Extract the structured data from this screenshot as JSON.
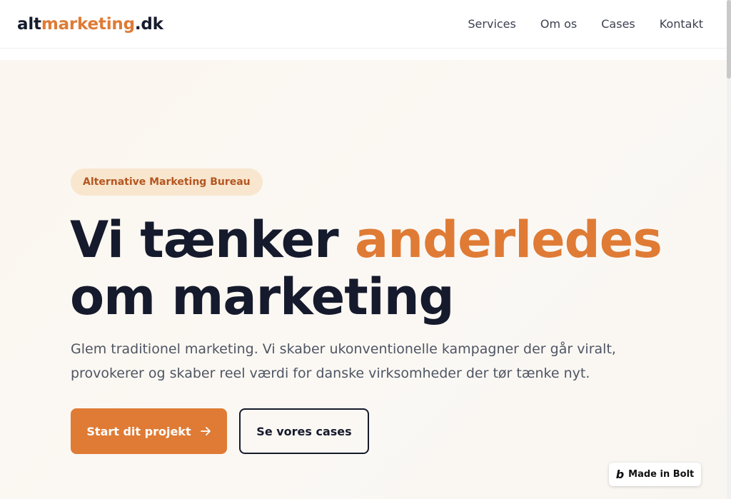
{
  "header": {
    "logo": {
      "prefix": "alt",
      "accent": "marketing",
      "suffix": ".dk"
    },
    "nav": [
      {
        "label": "Services"
      },
      {
        "label": "Om os"
      },
      {
        "label": "Cases"
      },
      {
        "label": "Kontakt"
      }
    ]
  },
  "hero": {
    "badge": "Alternative Marketing Bureau",
    "headline": {
      "part1": "Vi tænker ",
      "accent": "anderledes",
      "line2": "om marketing"
    },
    "lead": {
      "line1": "Glem traditionel marketing. Vi skaber ukonventionelle kampagner der går viralt,",
      "line2": "provokerer og skaber reel værdi for danske virksomheder der tør tænke nyt."
    },
    "primary_button": "Start dit projekt",
    "secondary_button": "Se vores cases"
  },
  "bolt_badge": {
    "label": "Made in Bolt",
    "icon": "b"
  },
  "icons": {
    "arrow": "arrow-right-icon",
    "bolt": "bolt-logo-icon"
  },
  "colors": {
    "accent": "#df7b35",
    "text_dark": "#151a2c",
    "badge_bg": "#f8e6cf",
    "badge_text": "#b4561f",
    "hero_bg": "#fbf7f2"
  }
}
